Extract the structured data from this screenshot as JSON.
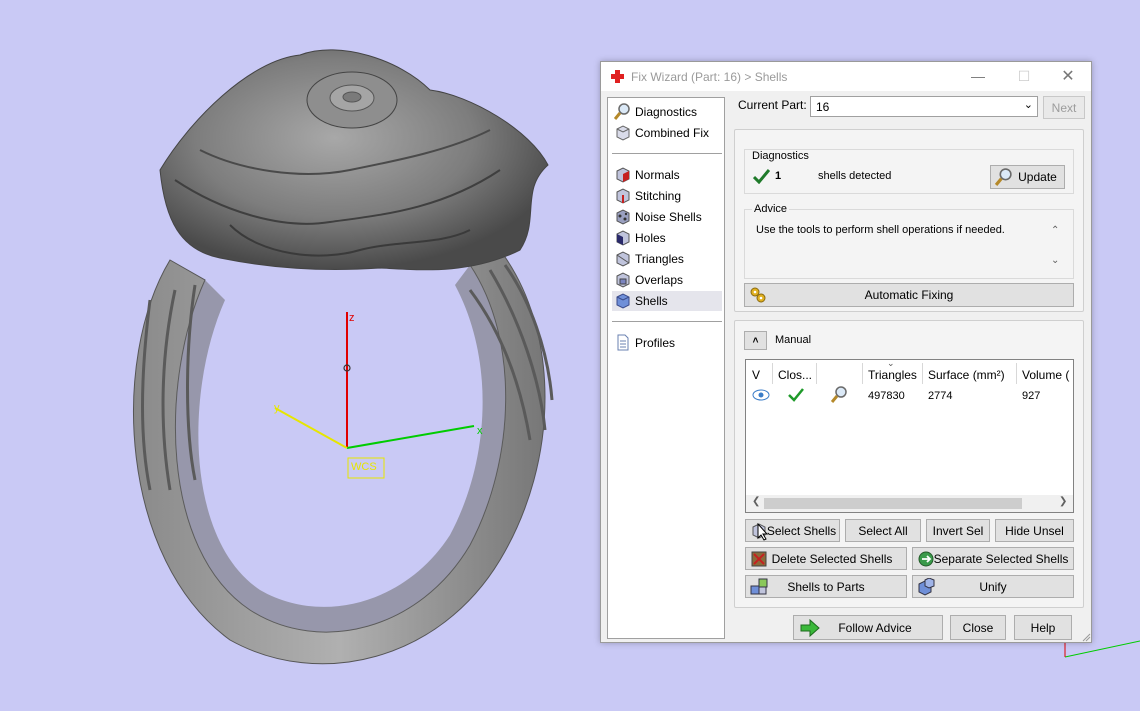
{
  "viewport": {
    "axis_z": "z",
    "axis_y": "y",
    "axis_x": "x",
    "wcs_label": "WCS"
  },
  "dialog": {
    "title": "Fix Wizard (Part: 16) > Shells",
    "window_controls": [
      "minimize",
      "maximize",
      "close"
    ],
    "nav": {
      "items_top": [
        {
          "label": "Diagnostics",
          "icon": "magnifier-icon"
        },
        {
          "label": "Combined Fix",
          "icon": "cube-icon"
        }
      ],
      "items_mid": [
        {
          "label": "Normals",
          "icon": "normals-cube-icon"
        },
        {
          "label": "Stitching",
          "icon": "stitching-cube-icon"
        },
        {
          "label": "Noise Shells",
          "icon": "noise-shells-icon"
        },
        {
          "label": "Holes",
          "icon": "holes-cube-icon"
        },
        {
          "label": "Triangles",
          "icon": "triangles-cube-icon"
        },
        {
          "label": "Overlaps",
          "icon": "overlaps-cube-icon"
        },
        {
          "label": "Shells",
          "icon": "shells-cube-icon",
          "selected": true
        }
      ],
      "items_bottom": [
        {
          "label": "Profiles",
          "icon": "document-icon"
        }
      ]
    },
    "current_part_label": "Current Part:",
    "current_part_value": "16",
    "next_button": "Next",
    "diagnostics": {
      "heading": "Diagnostics",
      "count": "1",
      "status_text": "shells detected",
      "update_button": "Update"
    },
    "advice": {
      "heading": "Advice",
      "text": "Use the tools to perform shell operations if needed."
    },
    "automatic_fixing_button": "Automatic Fixing",
    "manual": {
      "heading": "Manual",
      "columns": [
        "V",
        "Clos...",
        "",
        "Triangles",
        "Surface (mm²)",
        "Volume ("
      ],
      "rows": [
        {
          "triangles": "497830",
          "surface": "2774",
          "volume": "927"
        }
      ],
      "buttons": {
        "select_shells": "Select Shells",
        "select_all": "Select All",
        "invert_sel": "Invert Sel",
        "hide_unsel": "Hide Unsel",
        "delete_selected": "Delete Selected Shells",
        "separate_selected": "Separate Selected Shells",
        "shells_to_parts": "Shells to Parts",
        "unify": "Unify"
      }
    },
    "footer": {
      "follow_advice": "Follow Advice",
      "close": "Close",
      "help": "Help"
    }
  },
  "colors": {
    "background": "#c9c9f5",
    "axis_z": "#e00000",
    "axis_x": "#00cc00",
    "axis_y": "#e6e600",
    "check_green": "#1f9a2a",
    "title_icon_red": "#e02020"
  }
}
